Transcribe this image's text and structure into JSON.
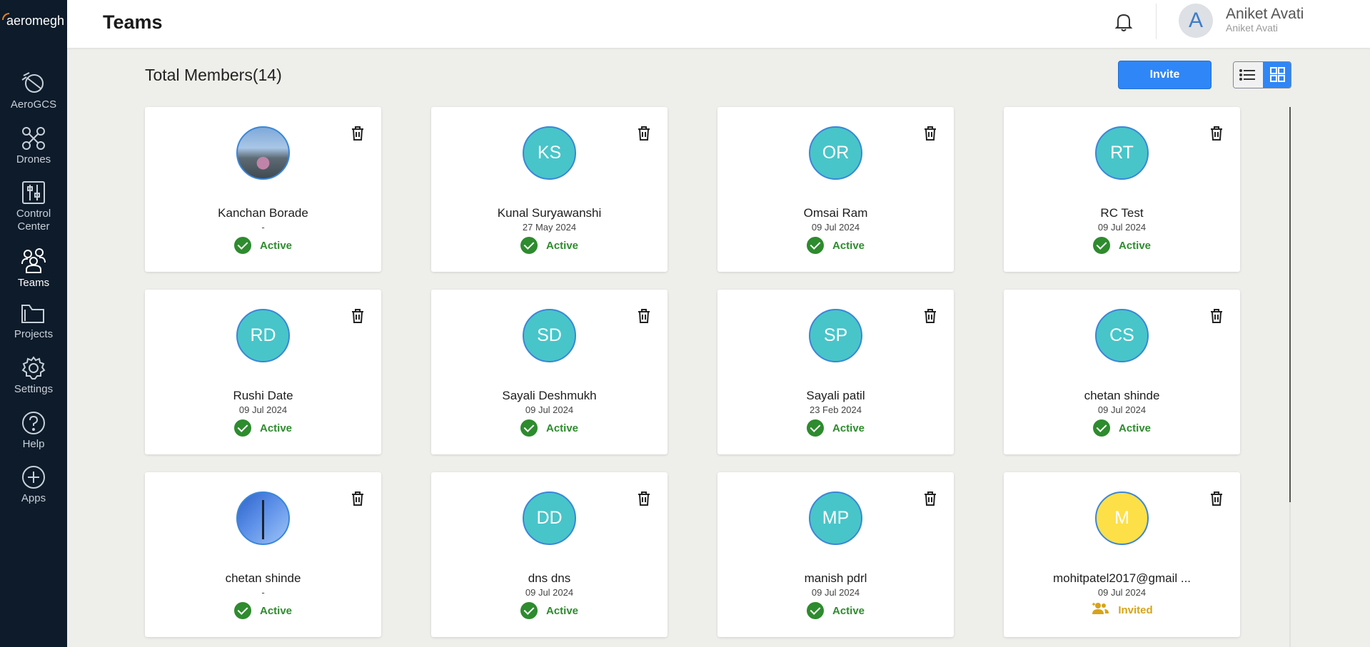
{
  "app": {
    "logo_text": "aeromegh"
  },
  "sidebar": {
    "items": [
      {
        "label": "AeroGCS",
        "icon": "satellite-dish-icon"
      },
      {
        "label": "Drones",
        "icon": "drone-icon"
      },
      {
        "label": "Control Center",
        "icon": "sliders-icon"
      },
      {
        "label": "Teams",
        "icon": "team-icon",
        "active": true
      },
      {
        "label": "Projects",
        "icon": "folder-icon"
      },
      {
        "label": "Settings",
        "icon": "gear-icon"
      },
      {
        "label": "Help",
        "icon": "help-icon"
      },
      {
        "label": "Apps",
        "icon": "plus-circle-icon"
      }
    ]
  },
  "header": {
    "title": "Teams",
    "user": {
      "initial": "A",
      "name": "Aniket Avati",
      "subtitle": "Aniket Avati"
    }
  },
  "toolbar": {
    "total_label": "Total Members(14)",
    "invite_label": "Invite"
  },
  "colors": {
    "sidebar": "#0d1b2a",
    "accent": "#2f86f6",
    "avatar": "#48c5c9",
    "active": "#2e8b2e",
    "invited": "#d6a41a"
  },
  "members": [
    {
      "initials": "",
      "avatar": "photo1",
      "name": "Kanchan Borade",
      "date": "-",
      "status": "Active"
    },
    {
      "initials": "KS",
      "avatar": "initials",
      "name": "Kunal Suryawanshi",
      "date": "27 May 2024",
      "status": "Active"
    },
    {
      "initials": "OR",
      "avatar": "initials",
      "name": "Omsai Ram",
      "date": "09 Jul 2024",
      "status": "Active"
    },
    {
      "initials": "RT",
      "avatar": "initials",
      "name": "RC Test",
      "date": "09 Jul 2024",
      "status": "Active"
    },
    {
      "initials": "RD",
      "avatar": "initials",
      "name": "Rushi Date",
      "date": "09 Jul 2024",
      "status": "Active"
    },
    {
      "initials": "SD",
      "avatar": "initials",
      "name": "Sayali Deshmukh",
      "date": "09 Jul 2024",
      "status": "Active"
    },
    {
      "initials": "SP",
      "avatar": "initials",
      "name": "Sayali patil",
      "date": "23 Feb 2024",
      "status": "Active"
    },
    {
      "initials": "CS",
      "avatar": "initials",
      "name": "chetan shinde",
      "date": "09 Jul 2024",
      "status": "Active"
    },
    {
      "initials": "",
      "avatar": "photo2",
      "name": "chetan shinde",
      "date": "-",
      "status": "Active"
    },
    {
      "initials": "DD",
      "avatar": "initials",
      "name": "dns dns",
      "date": "09 Jul 2024",
      "status": "Active"
    },
    {
      "initials": "MP",
      "avatar": "initials",
      "name": "manish pdrl",
      "date": "09 Jul 2024",
      "status": "Active"
    },
    {
      "initials": "M",
      "avatar": "yellow",
      "name": "mohitpatel2017@gmail ...",
      "date": "09 Jul 2024",
      "status": "Invited"
    }
  ]
}
